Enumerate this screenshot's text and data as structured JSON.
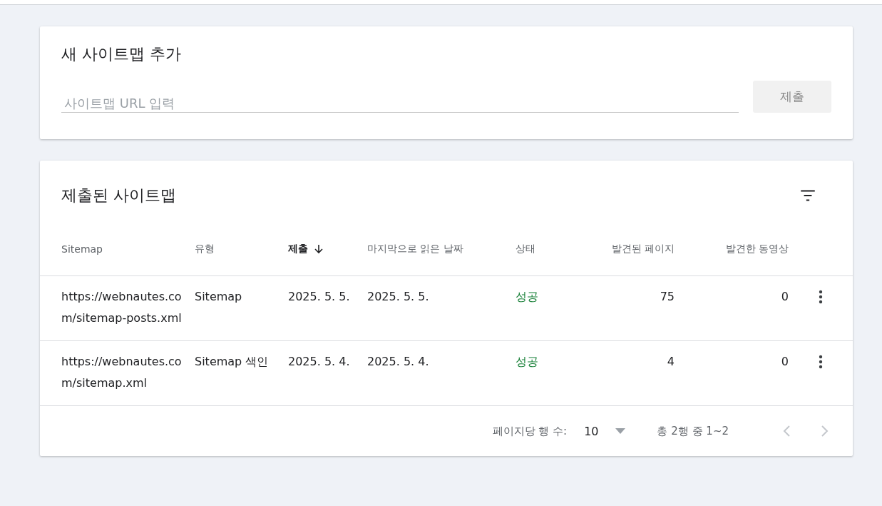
{
  "add_card": {
    "title": "새 사이트맵 추가",
    "url_field": {
      "placeholder": "사이트맵 URL 입력"
    },
    "submit_button": {
      "label": "제출",
      "disabled": true
    }
  },
  "submitted_card": {
    "title": "제출된 사이트맵",
    "table": {
      "columns": [
        {
          "label": "Sitemap",
          "sorted": false
        },
        {
          "label": "유형",
          "sorted": false
        },
        {
          "label": "제출",
          "sorted": true
        },
        {
          "label": "마지막으로 읽은 날짜",
          "sorted": false
        },
        {
          "label": "상태",
          "sorted": false
        },
        {
          "label": "발견된 페이지",
          "sorted": false
        },
        {
          "label": "발견한 동영상",
          "sorted": false
        }
      ],
      "rows": [
        {
          "cells": [
            "https://webnautes.com/sitemap-posts.xml",
            "Sitemap",
            "2025. 5. 5.",
            "2025. 5. 5.",
            "성공",
            "75",
            "0"
          ]
        },
        {
          "cells": [
            "https://webnautes.com/sitemap.xml",
            "Sitemap 색인",
            "2025. 5. 4.",
            "2025. 5. 4.",
            "성공",
            "4",
            "0"
          ]
        }
      ]
    },
    "pagination": {
      "rows_per_page_label": "페이지당 행 수:",
      "rows_per_page": "10",
      "range": "총 2행 중 1~2",
      "prev_disabled": true,
      "next_disabled": true
    }
  }
}
